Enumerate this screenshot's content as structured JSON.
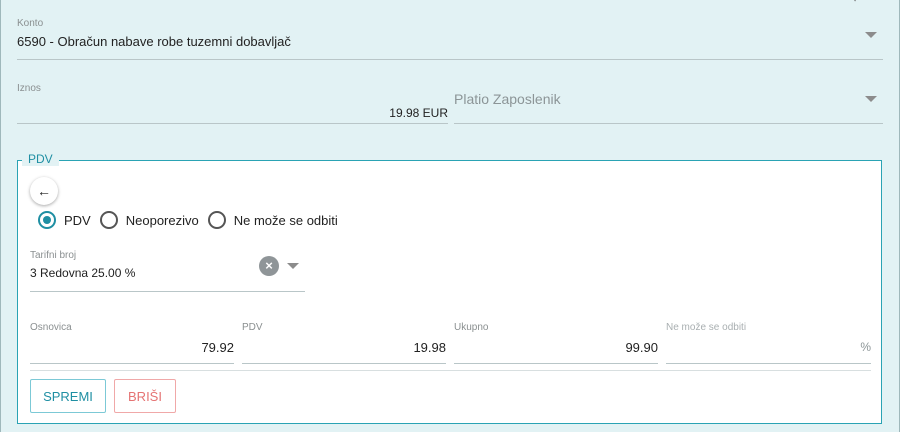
{
  "konto": {
    "label": "Konto",
    "value": "6590 - Obračun nabave robe tuzemni dobavljač"
  },
  "iznos": {
    "label": "Iznos",
    "value": "19.98 EUR",
    "payer_placeholder": "Platio Zaposlenik"
  },
  "pdv_section": {
    "legend": "PDV",
    "back_icon": "arrow-left-icon",
    "radio_options": [
      {
        "label": "PDV",
        "checked": true
      },
      {
        "label": "Neoporezivo",
        "checked": false
      },
      {
        "label": "Ne može se odbiti",
        "checked": false
      }
    ],
    "tarifni_broj": {
      "label": "Tarifni broj",
      "value": "3 Redovna 25.00 %"
    },
    "amounts": {
      "osnovica_label": "Osnovica",
      "osnovica_value": "79.92",
      "pdv_label": "PDV",
      "pdv_value": "19.98",
      "ukupno_label": "Ukupno",
      "ukupno_value": "99.90",
      "ne_moze_label": "Ne može se odbiti",
      "ne_moze_suffix": "%"
    },
    "buttons": {
      "save": "SPREMI",
      "delete": "BRIŠI"
    }
  },
  "colors": {
    "accent": "#1f8fa3",
    "background": "#e2f2f4",
    "delete": "#e57373"
  }
}
